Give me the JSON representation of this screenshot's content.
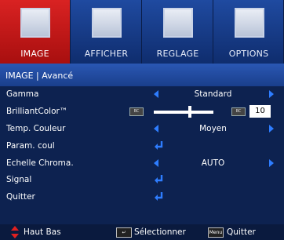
{
  "tabs": [
    {
      "label": "IMAGE",
      "icon": "image-icon",
      "active": true
    },
    {
      "label": "AFFICHER",
      "icon": "display-icon",
      "active": false
    },
    {
      "label": "REGLAGE",
      "icon": "projector-icon",
      "active": false
    },
    {
      "label": "OPTIONS",
      "icon": "options-icon",
      "active": false
    }
  ],
  "breadcrumb": "IMAGE  |  Avancé",
  "rows": {
    "gamma": {
      "label": "Gamma",
      "value": "Standard"
    },
    "brilliant": {
      "label": "BrilliantColor™",
      "value": "10",
      "level_fraction": 0.6
    },
    "temp": {
      "label": "Temp. Couleur",
      "value": "Moyen"
    },
    "param": {
      "label": "Param. coul"
    },
    "echelle": {
      "label": "Echelle Chroma.",
      "value": "AUTO"
    },
    "signal": {
      "label": "Signal"
    },
    "quitter": {
      "label": "Quitter"
    }
  },
  "footer": {
    "nav": "Haut Bas",
    "select": "Sélectionner",
    "menu_key": "Menu",
    "quit": "Quitter"
  },
  "colors": {
    "accent": "#d92222",
    "arrow": "#2e7dff",
    "background": "#0d2250"
  }
}
